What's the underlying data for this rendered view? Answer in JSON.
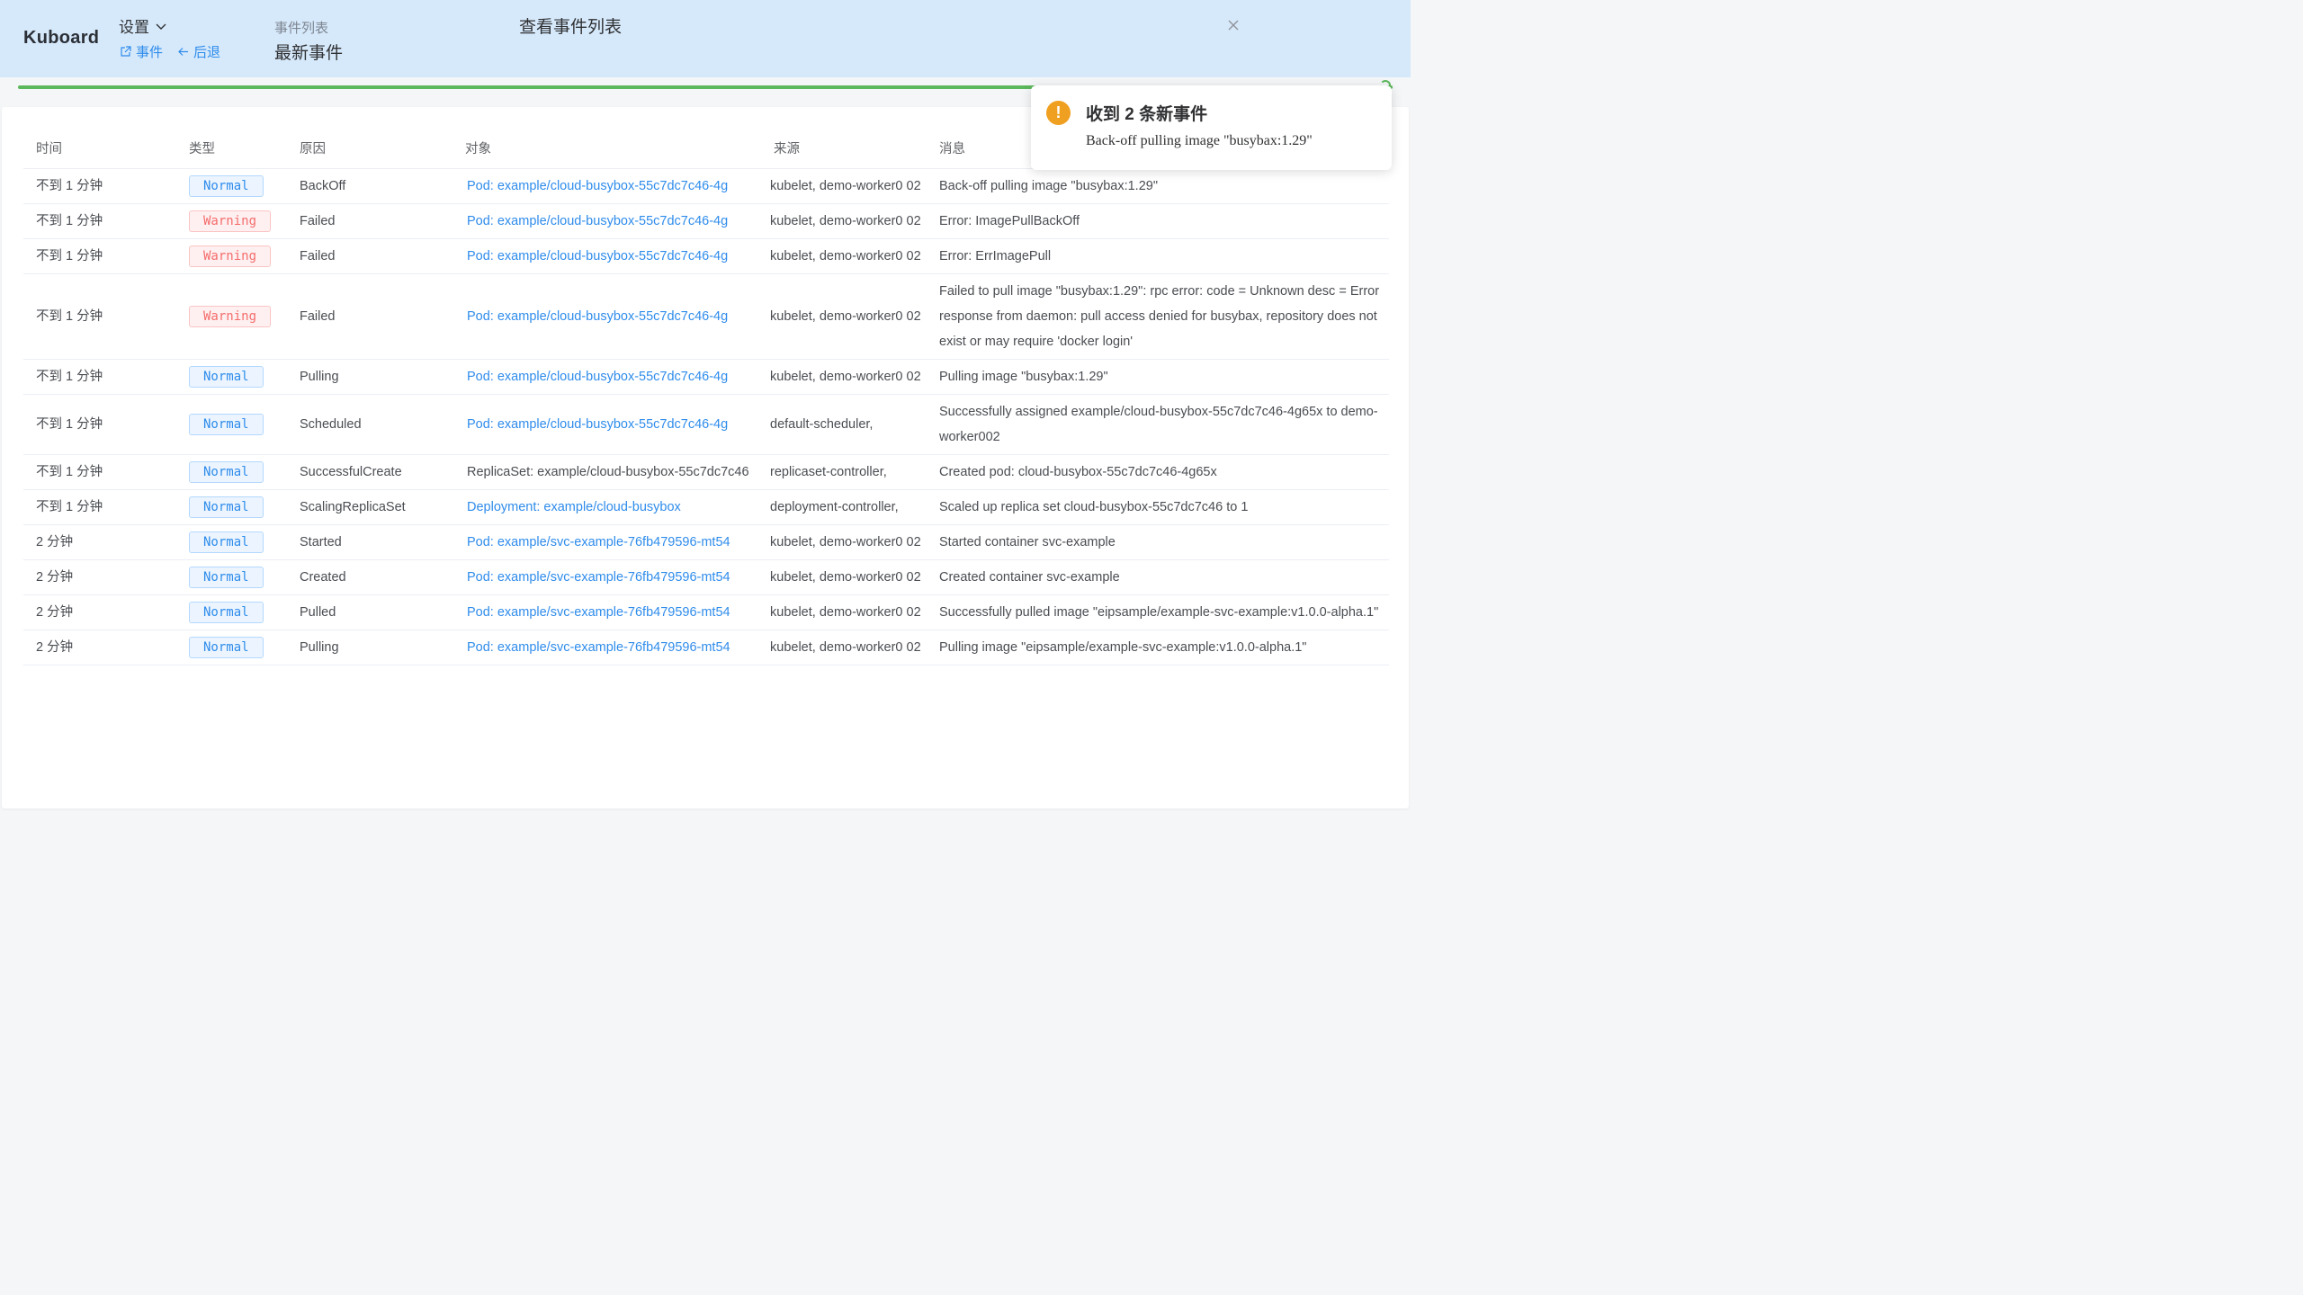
{
  "header": {
    "logo": "Kuboard",
    "settings_label": "设置",
    "links": [
      {
        "label": "事件",
        "icon": "external-link-icon"
      },
      {
        "label": "后退",
        "icon": "arrow-left-icon"
      }
    ],
    "breadcrumb_parent": "事件列表",
    "breadcrumb_current": "最新事件",
    "page_title": "查看事件列表"
  },
  "colors": {
    "header_bg": "#d6e9fb",
    "accent": "#2f8ceb",
    "normal": "#2f8ceb",
    "warning": "#f56c6c",
    "progress": "#5cb85c",
    "toast_icon": "#f0a020"
  },
  "table": {
    "columns": [
      "时间",
      "类型",
      "原因",
      "对象",
      "来源",
      "消息"
    ],
    "rows": [
      {
        "time": "不到 1 分钟",
        "type": "Normal",
        "reason": "BackOff",
        "object": "Pod: example/cloud-busybox-55c7dc7c46-4g",
        "source": "kubelet, demo-worker0 02",
        "message": "Back-off pulling image \"busybax:1.29\""
      },
      {
        "time": "不到 1 分钟",
        "type": "Warning",
        "reason": "Failed",
        "object": "Pod: example/cloud-busybox-55c7dc7c46-4g",
        "source": "kubelet, demo-worker0 02",
        "message": "Error: ImagePullBackOff"
      },
      {
        "time": "不到 1 分钟",
        "type": "Warning",
        "reason": "Failed",
        "object": "Pod: example/cloud-busybox-55c7dc7c46-4g",
        "source": "kubelet, demo-worker0 02",
        "message": "Error: ErrImagePull"
      },
      {
        "time": "不到 1 分钟",
        "type": "Warning",
        "reason": "Failed",
        "object": "Pod: example/cloud-busybox-55c7dc7c46-4g",
        "source": "kubelet, demo-worker0 02",
        "message": "Failed to pull image \"busybax:1.29\": rpc error: code = Unknown desc = Error response from daemon: pull access denied for busybax, repository does not exist or may require 'docker login'"
      },
      {
        "time": "不到 1 分钟",
        "type": "Normal",
        "reason": "Pulling",
        "object": "Pod: example/cloud-busybox-55c7dc7c46-4g",
        "source": "kubelet, demo-worker0 02",
        "message": "Pulling image \"busybax:1.29\""
      },
      {
        "time": "不到 1 分钟",
        "type": "Normal",
        "reason": "Scheduled",
        "object": "Pod: example/cloud-busybox-55c7dc7c46-4g",
        "source": "default-scheduler,",
        "message": "Successfully assigned example/cloud-busybox-55c7dc7c46-4g65x to demo-worker002"
      },
      {
        "time": "不到 1 分钟",
        "type": "Normal",
        "reason": "SuccessfulCreate",
        "object": "ReplicaSet: example/cloud-busybox-55c7dc7c46",
        "object_plain": true,
        "source": "replicaset-controller,",
        "message": "Created pod: cloud-busybox-55c7dc7c46-4g65x"
      },
      {
        "time": "不到 1 分钟",
        "type": "Normal",
        "reason": "ScalingReplicaSet",
        "object": "Deployment: example/cloud-busybox",
        "source": "deployment-controller,",
        "message": "Scaled up replica set cloud-busybox-55c7dc7c46 to 1"
      },
      {
        "time": "2 分钟",
        "type": "Normal",
        "reason": "Started",
        "object": "Pod: example/svc-example-76fb479596-mt54",
        "source": "kubelet, demo-worker0 02",
        "message": "Started container svc-example"
      },
      {
        "time": "2 分钟",
        "type": "Normal",
        "reason": "Created",
        "object": "Pod: example/svc-example-76fb479596-mt54",
        "source": "kubelet, demo-worker0 02",
        "message": "Created container svc-example"
      },
      {
        "time": "2 分钟",
        "type": "Normal",
        "reason": "Pulled",
        "object": "Pod: example/svc-example-76fb479596-mt54",
        "source": "kubelet, demo-worker0 02",
        "message": "Successfully pulled image \"eipsample/example-svc-example:v1.0.0-alpha.1\""
      },
      {
        "time": "2 分钟",
        "type": "Normal",
        "reason": "Pulling",
        "object": "Pod: example/svc-example-76fb479596-mt54",
        "source": "kubelet, demo-worker0 02",
        "message": "Pulling image \"eipsample/example-svc-example:v1.0.0-alpha.1\""
      }
    ]
  },
  "toast": {
    "icon": "warning-icon",
    "title": "收到 2 条新事件",
    "message": "Back-off pulling image \"busybax:1.29\""
  }
}
